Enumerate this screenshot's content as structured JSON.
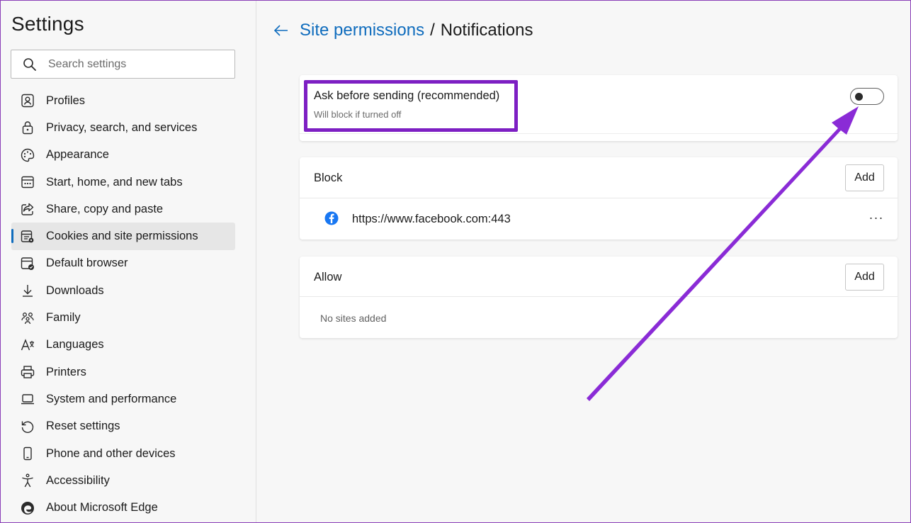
{
  "sidebar": {
    "title": "Settings",
    "search_placeholder": "Search settings",
    "items": [
      {
        "label": "Profiles",
        "icon": "profile-icon"
      },
      {
        "label": "Privacy, search, and services",
        "icon": "lock-icon"
      },
      {
        "label": "Appearance",
        "icon": "palette-icon"
      },
      {
        "label": "Start, home, and new tabs",
        "icon": "home-tabs-icon"
      },
      {
        "label": "Share, copy and paste",
        "icon": "share-icon"
      },
      {
        "label": "Cookies and site permissions",
        "icon": "cookies-icon",
        "active": true
      },
      {
        "label": "Default browser",
        "icon": "browser-icon"
      },
      {
        "label": "Downloads",
        "icon": "download-icon"
      },
      {
        "label": "Family",
        "icon": "family-icon"
      },
      {
        "label": "Languages",
        "icon": "languages-icon"
      },
      {
        "label": "Printers",
        "icon": "printer-icon"
      },
      {
        "label": "System and performance",
        "icon": "laptop-icon"
      },
      {
        "label": "Reset settings",
        "icon": "reset-icon"
      },
      {
        "label": "Phone and other devices",
        "icon": "phone-icon"
      },
      {
        "label": "Accessibility",
        "icon": "accessibility-icon"
      },
      {
        "label": "About Microsoft Edge",
        "icon": "edge-logo-icon"
      }
    ]
  },
  "header": {
    "breadcrumb_parent": "Site permissions",
    "separator": "/",
    "breadcrumb_current": "Notifications"
  },
  "ask_setting": {
    "title": "Ask before sending (recommended)",
    "subtitle": "Will block if turned off",
    "toggle_on": false
  },
  "block": {
    "title": "Block",
    "add_label": "Add",
    "sites": [
      {
        "url": "https://www.facebook.com:443",
        "icon": "facebook-icon"
      }
    ],
    "more_label": "···"
  },
  "allow": {
    "title": "Allow",
    "add_label": "Add",
    "empty_text": "No sites added"
  },
  "colors": {
    "accent": "#0f6cbd",
    "annotation": "#7d1fc3",
    "background": "#f7f7f7",
    "card": "#ffffff"
  }
}
